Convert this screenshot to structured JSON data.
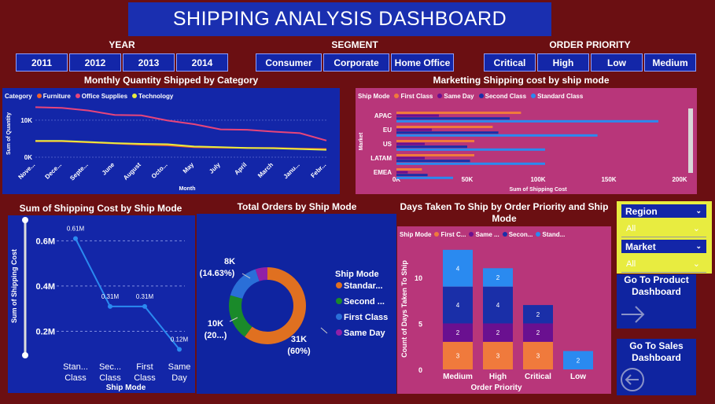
{
  "title": "SHIPPING ANALYSIS DASHBOARD",
  "filters": {
    "year": {
      "label": "YEAR",
      "options": [
        "2011",
        "2012",
        "2013",
        "2014"
      ]
    },
    "segment": {
      "label": "SEGMENT",
      "options": [
        "Consumer",
        "Corporate",
        "Home Office"
      ]
    },
    "priority": {
      "label": "ORDER PRIORITY",
      "options": [
        "Critical",
        "High",
        "Low",
        "Medium"
      ]
    }
  },
  "colors": {
    "bg": "#6b0f12",
    "blue": "#1326a8",
    "pink": "#b8367a",
    "furniture": "#f0622b",
    "office": "#e8457a",
    "technology": "#e8ec40"
  },
  "panels": {
    "monthly": "Monthly Quantity Shipped by Category",
    "marketing": "Marketting Shipping cost by ship mode",
    "shipcost": "Sum of Shipping Cost by Ship Mode",
    "orders": "Total Orders by Ship Mode",
    "days": "Days Taken To Ship by Order Priority and Ship Mode"
  },
  "slicers": {
    "region": {
      "label": "Region",
      "value": "All"
    },
    "market": {
      "label": "Market",
      "value": "All"
    }
  },
  "nav": {
    "product": "Go To Product Dashboard",
    "sales": "Go To Sales Dashboard"
  },
  "chart_data": [
    {
      "type": "line",
      "title": "Monthly Quantity Shipped by Category",
      "legend_title": "Category",
      "xlabel": "Month",
      "ylabel": "Sum of Quantity",
      "categories": [
        "Nove...",
        "Dece...",
        "Septe...",
        "June",
        "August",
        "Octo...",
        "May",
        "July",
        "April",
        "March",
        "Janu...",
        "Febr..."
      ],
      "yticks": [
        "0K",
        "10K"
      ],
      "ylim": [
        0,
        14000
      ],
      "series": [
        {
          "name": "Furniture",
          "values": [
            4300,
            4300,
            4000,
            3700,
            3400,
            3200,
            2700,
            2600,
            2500,
            2500,
            2300,
            2200
          ]
        },
        {
          "name": "Office Supplies",
          "values": [
            13500,
            13300,
            12600,
            11400,
            11300,
            9900,
            8900,
            7500,
            7400,
            6900,
            6500,
            4500
          ]
        },
        {
          "name": "Technology",
          "values": [
            4400,
            4400,
            4100,
            3800,
            3600,
            3500,
            2900,
            2700,
            2500,
            2400,
            2200,
            2000
          ]
        }
      ]
    },
    {
      "type": "bar",
      "orientation": "horizontal",
      "title": "Marketting Shipping cost by ship mode",
      "legend_title": "Ship Mode",
      "xlabel": "Sum of Shipping Cost",
      "ylabel": "Market",
      "categories": [
        "APAC",
        "EU",
        "US",
        "LATAM",
        "EMEA"
      ],
      "xticks": [
        "0K",
        "50K",
        "100K",
        "150K",
        "200K"
      ],
      "xlim": [
        0,
        200000
      ],
      "series": [
        {
          "name": "First Class",
          "values": [
            88000,
            68000,
            55000,
            55000,
            18000
          ]
        },
        {
          "name": "Same Day",
          "values": [
            30000,
            25000,
            20000,
            20000,
            8000
          ]
        },
        {
          "name": "Second Class",
          "values": [
            80000,
            72000,
            50000,
            52000,
            22000
          ]
        },
        {
          "name": "Standard Class",
          "values": [
            185000,
            142000,
            105000,
            105000,
            40000
          ]
        }
      ]
    },
    {
      "type": "line",
      "title": "Sum of Shipping Cost by Ship Mode",
      "xlabel": "Ship Mode",
      "ylabel": "Sum of Shipping Cost",
      "categories": [
        "Stan... Class",
        "Sec... Class",
        "First Class",
        "Same Day"
      ],
      "values": [
        610000,
        310000,
        310000,
        120000
      ],
      "labels": [
        "0.61M",
        "0.31M",
        "0.31M",
        "0.12M"
      ],
      "yticks": [
        "0.2M",
        "0.4M",
        "0.6M"
      ],
      "ylim": [
        80000,
        650000
      ]
    },
    {
      "type": "pie",
      "donut": true,
      "title": "Total Orders by Ship Mode",
      "legend_title": "Ship Mode",
      "series": [
        {
          "name": "Standar...",
          "value": 31000,
          "label": "31K (60%)",
          "color": "#e07020"
        },
        {
          "name": "Second ...",
          "value": 10000,
          "label": "10K (20...)",
          "color": "#1a8a2a"
        },
        {
          "name": "First Class",
          "value": 8000,
          "label": "8K (14.63%)",
          "color": "#2a6fd8"
        },
        {
          "name": "Same Day",
          "value": 2700,
          "label": "",
          "color": "#9020a8"
        }
      ]
    },
    {
      "type": "bar",
      "stacked": true,
      "title": "Days Taken To Ship by Order Priority and Ship Mode",
      "legend_title": "Ship Mode",
      "xlabel": "Order Priority",
      "ylabel": "Count of Days Taken To Ship",
      "categories": [
        "Medium",
        "High",
        "Critical",
        "Low"
      ],
      "yticks": [
        "0",
        "5",
        "10"
      ],
      "ylim": [
        0,
        13.5
      ],
      "series": [
        {
          "name": "First C...",
          "values": [
            3,
            3,
            3,
            0
          ],
          "color": "#f07a3c"
        },
        {
          "name": "Same ...",
          "values": [
            2,
            2,
            2,
            0
          ],
          "color": "#6a1090"
        },
        {
          "name": "Secon...",
          "values": [
            4,
            4,
            2,
            0
          ],
          "color": "#1a2fa8"
        },
        {
          "name": "Stand...",
          "values": [
            4,
            2,
            0,
            2
          ],
          "color": "#2a8af0"
        }
      ]
    }
  ]
}
